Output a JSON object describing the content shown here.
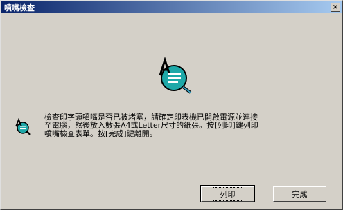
{
  "window": {
    "title": "噴嘴檢查"
  },
  "titlebar": {
    "close_label": "×"
  },
  "message": {
    "line1": "檢查印字頭噴嘴是否已被堵塞，請確定印表機已開啟電源並連接",
    "line2": "至電腦，然後放入數張A4或Letter尺寸的紙張。按[列印]鍵列印",
    "line3": "噴嘴檢查表單。按[完成]鍵離開。"
  },
  "buttons": {
    "print_label": "列印",
    "finish_label": "完成"
  },
  "icons": {
    "hero": "nozzle-check-icon",
    "small": "nozzle-check-icon"
  }
}
